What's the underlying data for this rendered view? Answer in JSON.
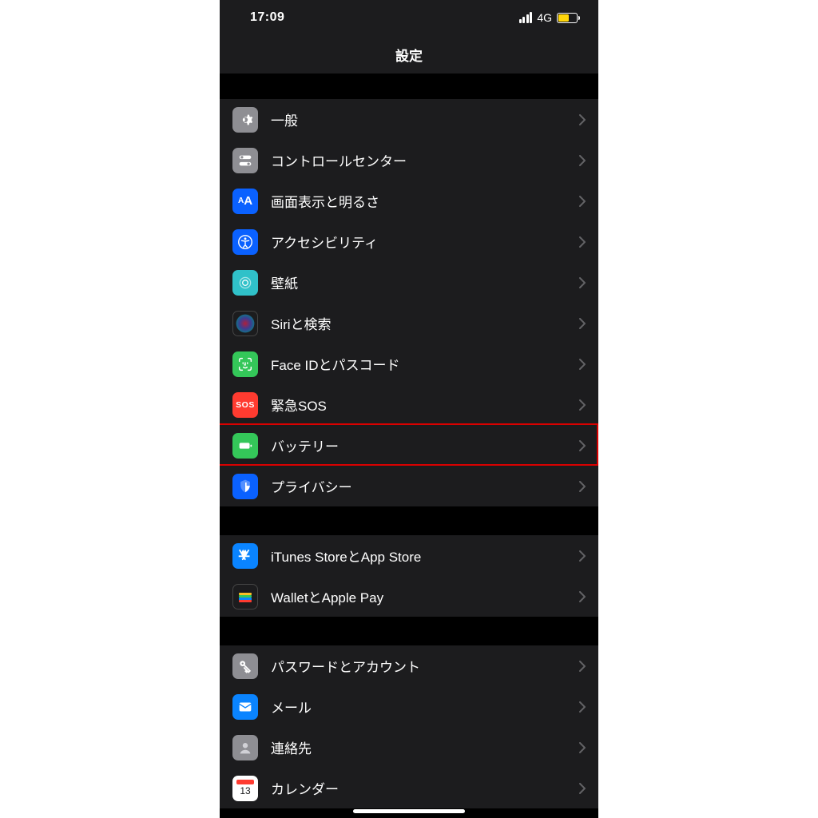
{
  "statusbar": {
    "time": "17:09",
    "connection": "4G"
  },
  "header": {
    "title": "設定"
  },
  "sections": {
    "s1": {
      "items": [
        {
          "id": "general",
          "label": "一般"
        },
        {
          "id": "control-center",
          "label": "コントロールセンター"
        },
        {
          "id": "display",
          "label": "画面表示と明るさ"
        },
        {
          "id": "accessibility",
          "label": "アクセシビリティ"
        },
        {
          "id": "wallpaper",
          "label": "壁紙"
        },
        {
          "id": "siri",
          "label": "Siriと検索"
        },
        {
          "id": "faceid",
          "label": "Face IDとパスコード"
        },
        {
          "id": "sos",
          "label": "緊急SOS"
        },
        {
          "id": "battery",
          "label": "バッテリー",
          "highlighted": true
        },
        {
          "id": "privacy",
          "label": "プライバシー"
        }
      ]
    },
    "s2": {
      "items": [
        {
          "id": "itunes",
          "label": "iTunes StoreとApp Store"
        },
        {
          "id": "wallet",
          "label": "WalletとApple Pay"
        }
      ]
    },
    "s3": {
      "items": [
        {
          "id": "passwords",
          "label": "パスワードとアカウント"
        },
        {
          "id": "mail",
          "label": "メール"
        },
        {
          "id": "contacts",
          "label": "連絡先"
        },
        {
          "id": "calendar",
          "label": "カレンダー"
        }
      ]
    }
  },
  "sos_text": "SOS"
}
